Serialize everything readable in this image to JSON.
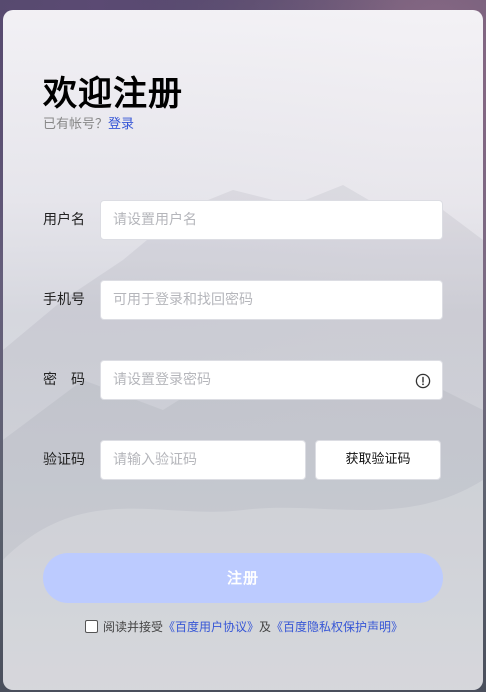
{
  "header": {
    "title": "欢迎注册",
    "has_account_text": "已有帐号？",
    "login_link": "登录"
  },
  "form": {
    "username": {
      "label": "用户名",
      "placeholder": "请设置用户名",
      "value": ""
    },
    "phone": {
      "label": "手机号",
      "placeholder": "可用于登录和找回密码",
      "value": ""
    },
    "password": {
      "label": "密　码",
      "placeholder": "请设置登录密码",
      "value": "",
      "icon": "alert-circle-icon"
    },
    "code": {
      "label": "验证码",
      "placeholder": "请输入验证码",
      "value": "",
      "send_button": "获取验证码"
    }
  },
  "submit_label": "注册",
  "agreement": {
    "checked": false,
    "prefix": "阅读并接受",
    "user_agreement": "《百度用户协议》",
    "and": "及",
    "privacy_statement": "《百度隐私权保护声明》"
  },
  "colors": {
    "accent_link": "#3656d6",
    "submit_disabled": "#bccbff"
  }
}
